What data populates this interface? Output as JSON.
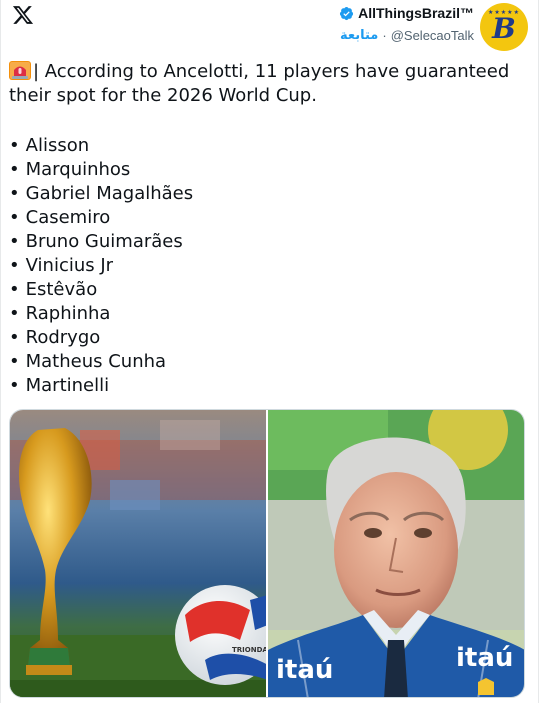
{
  "header": {
    "display_name": "AllThingsBrazil™",
    "follow_label": "متابعة",
    "separator": "·",
    "handle": "@SelecaoTalk",
    "avatar_letter": "B"
  },
  "tweet": {
    "emoji_name": "siren-icon",
    "intro": "| According to Ancelotti, 11 players have guaranteed their spot for the 2026 World Cup.",
    "players": [
      "Alisson",
      "Marquinhos",
      "Gabriel Magalhães",
      "Casemiro",
      "Bruno Guimarães",
      "Vinicius Jr",
      "Estêvão",
      "Raphinha",
      "Rodrygo",
      "Matheus Cunha",
      "Martinelli"
    ]
  },
  "media": {
    "left_image": "world-cup-trophy-and-ball",
    "right_image": "ancelotti-portrait",
    "ball_brand_text": "TRIONDA",
    "sponsor_text": "itaú"
  },
  "colors": {
    "accent": "#1d9bf0",
    "avatar_bg": "#f3c60f",
    "avatar_letter": "#1e3a8a"
  }
}
